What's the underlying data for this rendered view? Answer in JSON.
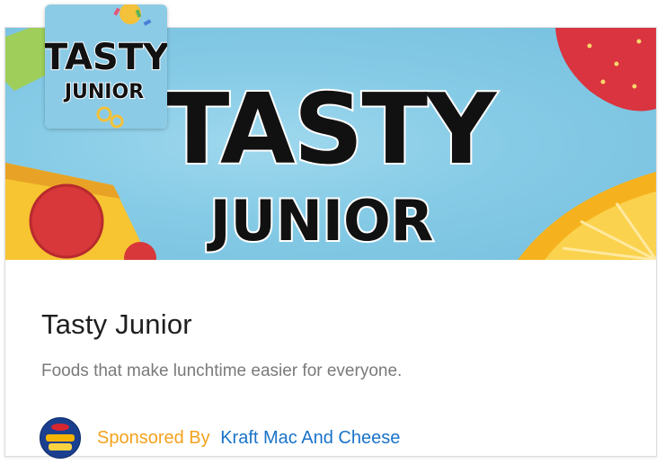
{
  "banner": {
    "title_line1": "TASTY",
    "title_line2": "JUNIOR"
  },
  "thumbnail": {
    "line1": "TASTY",
    "line2": "JUNIOR"
  },
  "card": {
    "title": "Tasty Junior",
    "description": "Foods that make lunchtime easier for everyone.",
    "sponsor_label": "Sponsored By",
    "sponsor_name": "Kraft Mac And Cheese",
    "sponsor_logo_icon": "kraft-mac-and-cheese-logo-icon"
  },
  "colors": {
    "sponsor_label": "#f4a21d",
    "sponsor_link": "#1a73c9",
    "title": "#1f1f1f",
    "description": "#7a7a7a"
  }
}
